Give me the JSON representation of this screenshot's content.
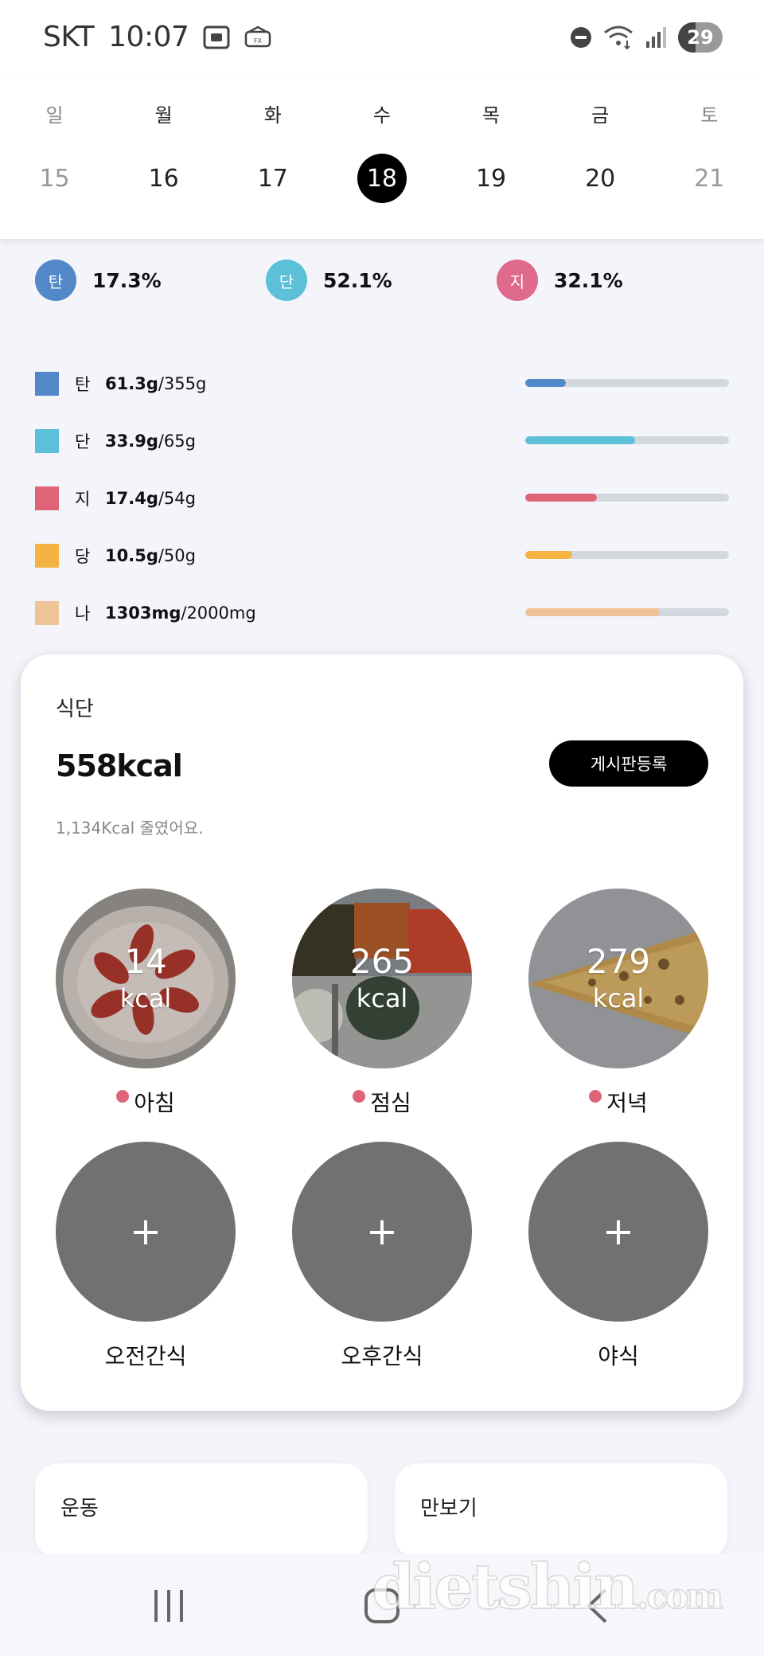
{
  "status_bar": {
    "carrier": "SKT",
    "time": "10:07",
    "battery": "29",
    "icons": [
      "screenshot-icon",
      "app-notification-icon",
      "do-not-disturb-icon",
      "wifi-icon",
      "signal-icon",
      "battery-icon"
    ]
  },
  "calendar": {
    "weekdays": [
      "일",
      "월",
      "화",
      "수",
      "목",
      "금",
      "토"
    ],
    "dates": [
      "15",
      "16",
      "17",
      "18",
      "19",
      "20",
      "21"
    ],
    "selected_index": 3
  },
  "ratios": [
    {
      "label": "탄",
      "percent": "17.3%",
      "color": "#5287c8"
    },
    {
      "label": "단",
      "percent": "52.1%",
      "color": "#5bc0d8"
    },
    {
      "label": "지",
      "percent": "32.1%",
      "color": "#e06a8c"
    }
  ],
  "nutrients": [
    {
      "label": "탄",
      "amount": "61.3g",
      "target": "/355g",
      "color": "#5287c8",
      "progress": 0.2
    },
    {
      "label": "단",
      "amount": "33.9g",
      "target": "/65g",
      "color": "#5bc0d8",
      "progress": 0.54
    },
    {
      "label": "지",
      "amount": "17.4g",
      "target": "/54g",
      "color": "#e06478",
      "progress": 0.35
    },
    {
      "label": "당",
      "amount": "10.5g",
      "target": "/50g",
      "color": "#f5b342",
      "progress": 0.23
    },
    {
      "label": "나",
      "amount": "1303mg",
      "target": "/2000mg",
      "color": "#efc397",
      "progress": 0.66
    }
  ],
  "meal_card": {
    "title": "식단",
    "total_kcal": "558kcal",
    "subtitle": "1,134Kcal 줄였어요.",
    "post_button": "게시판등록",
    "meals": [
      {
        "name": "아침",
        "kcal": "14",
        "unit": "kcal"
      },
      {
        "name": "점심",
        "kcal": "265",
        "unit": "kcal"
      },
      {
        "name": "저녁",
        "kcal": "279",
        "unit": "kcal"
      }
    ],
    "snacks": [
      {
        "name": "오전간식",
        "icon": "+"
      },
      {
        "name": "오후간식",
        "icon": "+"
      },
      {
        "name": "야식",
        "icon": "+"
      }
    ]
  },
  "bottom_cards": {
    "exercise": "운동",
    "pedometer": "만보기"
  },
  "watermark": {
    "main": "dietshin",
    "suffix": ".com"
  }
}
